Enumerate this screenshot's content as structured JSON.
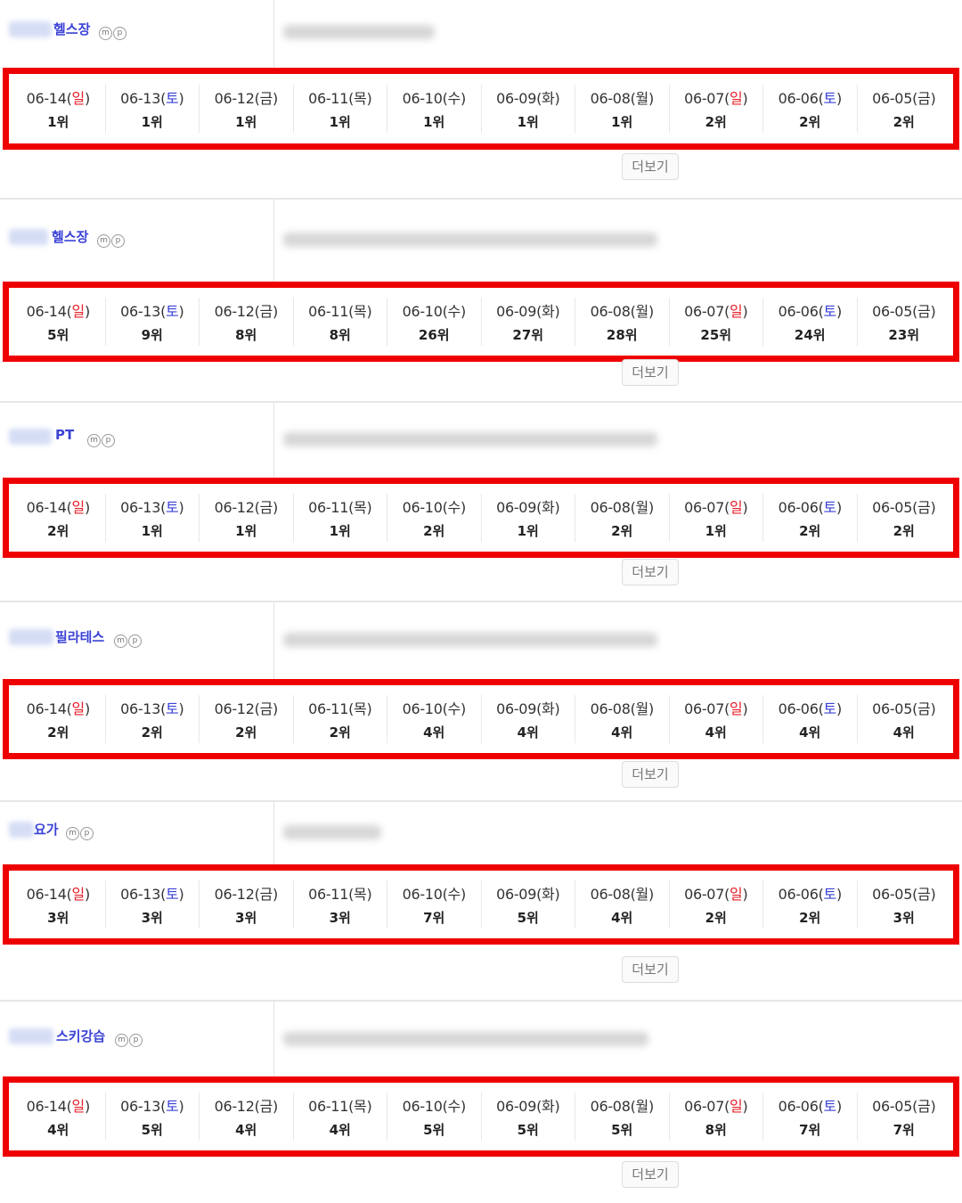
{
  "more_label": "더보기",
  "colors": {
    "sunday": "#e8202a",
    "saturday": "#3b43d6",
    "frame": "#ee0000",
    "keyword": "#3b43d6"
  },
  "mp_badges": [
    "m",
    "p"
  ],
  "blocks": [
    {
      "keyword": "헬스장",
      "days": [
        {
          "date": "06-14",
          "dow": "일",
          "rank": "1위"
        },
        {
          "date": "06-13",
          "dow": "토",
          "rank": "1위"
        },
        {
          "date": "06-12",
          "dow": "금",
          "rank": "1위"
        },
        {
          "date": "06-11",
          "dow": "목",
          "rank": "1위"
        },
        {
          "date": "06-10",
          "dow": "수",
          "rank": "1위"
        },
        {
          "date": "06-09",
          "dow": "화",
          "rank": "1위"
        },
        {
          "date": "06-08",
          "dow": "월",
          "rank": "1위"
        },
        {
          "date": "06-07",
          "dow": "일",
          "rank": "2위"
        },
        {
          "date": "06-06",
          "dow": "토",
          "rank": "2위"
        },
        {
          "date": "06-05",
          "dow": "금",
          "rank": "2위"
        }
      ]
    },
    {
      "keyword": "헬스장",
      "days": [
        {
          "date": "06-14",
          "dow": "일",
          "rank": "5위"
        },
        {
          "date": "06-13",
          "dow": "토",
          "rank": "9위"
        },
        {
          "date": "06-12",
          "dow": "금",
          "rank": "8위"
        },
        {
          "date": "06-11",
          "dow": "목",
          "rank": "8위"
        },
        {
          "date": "06-10",
          "dow": "수",
          "rank": "26위"
        },
        {
          "date": "06-09",
          "dow": "화",
          "rank": "27위"
        },
        {
          "date": "06-08",
          "dow": "월",
          "rank": "28위"
        },
        {
          "date": "06-07",
          "dow": "일",
          "rank": "25위"
        },
        {
          "date": "06-06",
          "dow": "토",
          "rank": "24위"
        },
        {
          "date": "06-05",
          "dow": "금",
          "rank": "23위"
        }
      ]
    },
    {
      "keyword": "PT",
      "days": [
        {
          "date": "06-14",
          "dow": "일",
          "rank": "2위"
        },
        {
          "date": "06-13",
          "dow": "토",
          "rank": "1위"
        },
        {
          "date": "06-12",
          "dow": "금",
          "rank": "1위"
        },
        {
          "date": "06-11",
          "dow": "목",
          "rank": "1위"
        },
        {
          "date": "06-10",
          "dow": "수",
          "rank": "2위"
        },
        {
          "date": "06-09",
          "dow": "화",
          "rank": "1위"
        },
        {
          "date": "06-08",
          "dow": "월",
          "rank": "2위"
        },
        {
          "date": "06-07",
          "dow": "일",
          "rank": "1위"
        },
        {
          "date": "06-06",
          "dow": "토",
          "rank": "2위"
        },
        {
          "date": "06-05",
          "dow": "금",
          "rank": "2위"
        }
      ]
    },
    {
      "keyword": "필라테스",
      "days": [
        {
          "date": "06-14",
          "dow": "일",
          "rank": "2위"
        },
        {
          "date": "06-13",
          "dow": "토",
          "rank": "2위"
        },
        {
          "date": "06-12",
          "dow": "금",
          "rank": "2위"
        },
        {
          "date": "06-11",
          "dow": "목",
          "rank": "2위"
        },
        {
          "date": "06-10",
          "dow": "수",
          "rank": "4위"
        },
        {
          "date": "06-09",
          "dow": "화",
          "rank": "4위"
        },
        {
          "date": "06-08",
          "dow": "월",
          "rank": "4위"
        },
        {
          "date": "06-07",
          "dow": "일",
          "rank": "4위"
        },
        {
          "date": "06-06",
          "dow": "토",
          "rank": "4위"
        },
        {
          "date": "06-05",
          "dow": "금",
          "rank": "4위"
        }
      ]
    },
    {
      "keyword": "요가",
      "days": [
        {
          "date": "06-14",
          "dow": "일",
          "rank": "3위"
        },
        {
          "date": "06-13",
          "dow": "토",
          "rank": "3위"
        },
        {
          "date": "06-12",
          "dow": "금",
          "rank": "3위"
        },
        {
          "date": "06-11",
          "dow": "목",
          "rank": "3위"
        },
        {
          "date": "06-10",
          "dow": "수",
          "rank": "7위"
        },
        {
          "date": "06-09",
          "dow": "화",
          "rank": "5위"
        },
        {
          "date": "06-08",
          "dow": "월",
          "rank": "4위"
        },
        {
          "date": "06-07",
          "dow": "일",
          "rank": "2위"
        },
        {
          "date": "06-06",
          "dow": "토",
          "rank": "2위"
        },
        {
          "date": "06-05",
          "dow": "금",
          "rank": "3위"
        }
      ]
    },
    {
      "keyword": "스키강습",
      "days": [
        {
          "date": "06-14",
          "dow": "일",
          "rank": "4위"
        },
        {
          "date": "06-13",
          "dow": "토",
          "rank": "5위"
        },
        {
          "date": "06-12",
          "dow": "금",
          "rank": "4위"
        },
        {
          "date": "06-11",
          "dow": "목",
          "rank": "4위"
        },
        {
          "date": "06-10",
          "dow": "수",
          "rank": "5위"
        },
        {
          "date": "06-09",
          "dow": "화",
          "rank": "5위"
        },
        {
          "date": "06-08",
          "dow": "월",
          "rank": "5위"
        },
        {
          "date": "06-07",
          "dow": "일",
          "rank": "8위"
        },
        {
          "date": "06-06",
          "dow": "토",
          "rank": "7위"
        },
        {
          "date": "06-05",
          "dow": "금",
          "rank": "7위"
        }
      ]
    }
  ]
}
